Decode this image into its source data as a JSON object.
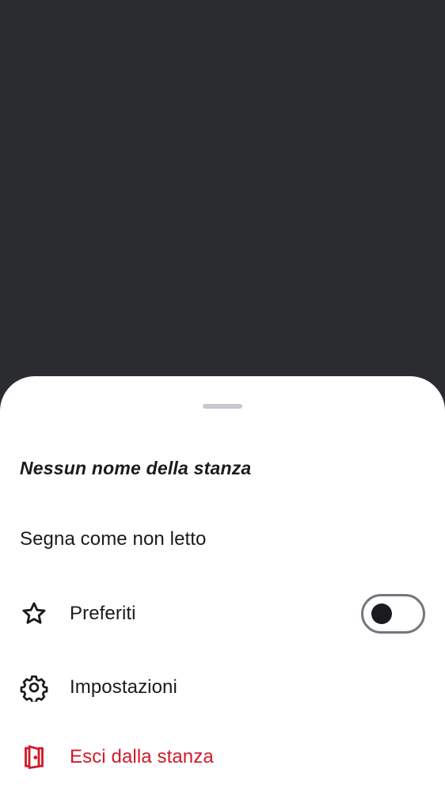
{
  "sheet": {
    "room_name": "Nessun nome della stanza",
    "mark_unread_label": "Segna come non letto",
    "favorites": {
      "label": "Preferiti",
      "icon": "star-outline-icon",
      "toggle_on": false
    },
    "settings": {
      "label": "Impostazioni",
      "icon": "gear-icon"
    },
    "leave": {
      "label": "Esci dalla stanza",
      "icon": "leave-door-icon",
      "color": "#d11a2a"
    }
  },
  "colors": {
    "backdrop": "#2b2c2f",
    "sheet": "#ffffff",
    "text": "#1b1b1f",
    "danger": "#d11a2a",
    "handle": "#c6c7cf",
    "toggle_border": "#74777f"
  }
}
